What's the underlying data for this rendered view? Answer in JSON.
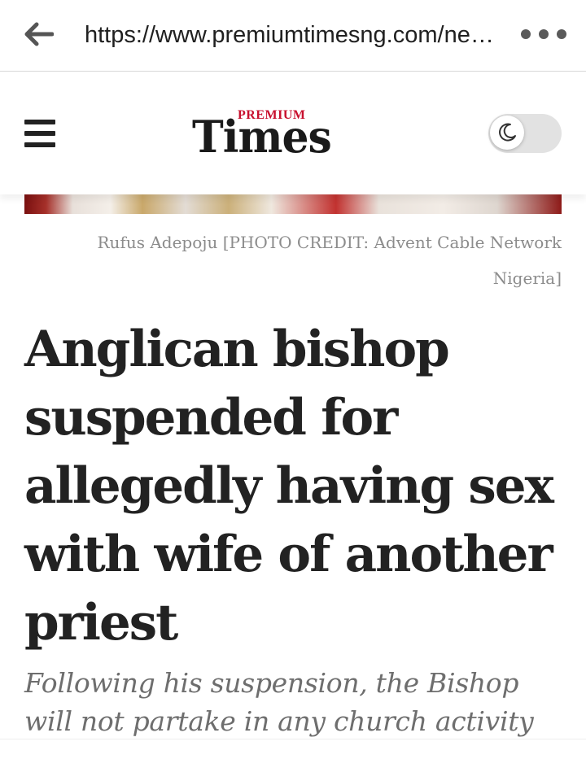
{
  "browser": {
    "url": "https://www.premiumtimesng.com/ne…",
    "back_icon": "arrow-left-icon",
    "menu_icon": "more-horizontal-icon"
  },
  "header": {
    "logo_small": "PREMIUM",
    "logo_large": "Times",
    "menu_icon": "hamburger-icon",
    "dark_mode_icon": "moon-icon",
    "dark_mode_on": false,
    "brand_red": "#c8102e"
  },
  "article": {
    "caption": "Rufus Adepoju [PHOTO CREDIT: Advent Cable Network Nigeria]",
    "headline": "Anglican bishop suspended for allegedly having sex with wife of another priest",
    "subheadline": "Following his suspension, the Bishop will not partake in any church activity"
  }
}
